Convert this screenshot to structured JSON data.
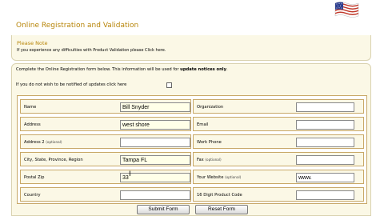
{
  "header": {
    "title": "Online Registration and Validation",
    "flag_icon": "us-flag-icon"
  },
  "note": {
    "title": "Please Note",
    "text": "If you experience any difficulties with Product Validation please Click here."
  },
  "form": {
    "intro_prefix": "Complete the Online Registration form below. This information will be used for ",
    "intro_bold": "update notices only",
    "intro_suffix": ".",
    "optout_label": "If you do not wish to be notified of updates click here",
    "optout_checked": false,
    "rows": [
      {
        "left": {
          "label": "Name",
          "optional": "",
          "value": "Bill Snyder"
        },
        "right": {
          "label": "Organization",
          "optional": "",
          "value": ""
        }
      },
      {
        "left": {
          "label": "Address",
          "optional": "",
          "value": "west shore"
        },
        "right": {
          "label": "Email",
          "optional": "",
          "value": ""
        }
      },
      {
        "left": {
          "label": "Address 2 ",
          "optional": "(optional)",
          "value": ""
        },
        "right": {
          "label": "Work Phone",
          "optional": "",
          "value": ""
        }
      },
      {
        "left": {
          "label": "City, State, Province, Region",
          "optional": "",
          "value": "Tampa FL"
        },
        "right": {
          "label": "Fax ",
          "optional": "(optional)",
          "value": ""
        }
      },
      {
        "left": {
          "label": "Postal Zip",
          "optional": "",
          "value": "33"
        },
        "right": {
          "label": "Your Website ",
          "optional": "(optional)",
          "value": "www."
        }
      },
      {
        "left": {
          "label": "Country",
          "optional": "",
          "value": ""
        },
        "right": {
          "label": "16 Digit Product Code",
          "optional": "",
          "value": ""
        }
      }
    ],
    "submit_label": "Submit Form",
    "reset_label": "Reset Form"
  }
}
